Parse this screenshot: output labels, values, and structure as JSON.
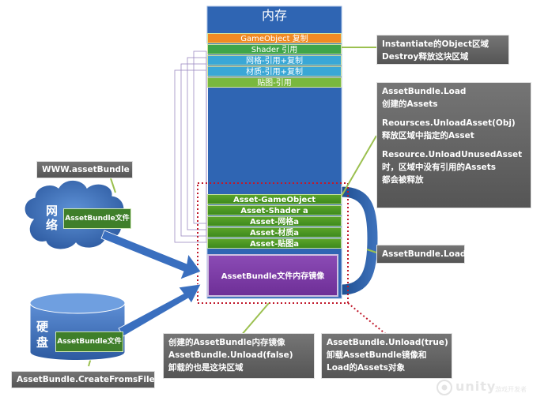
{
  "memory": {
    "title": "内存",
    "stack": [
      {
        "label": "GameObject 复制",
        "color": "#f08a24"
      },
      {
        "label": "Shader 引用",
        "color": "#3fa54a"
      },
      {
        "label": "网格-引用+复制",
        "color": "#3aa7d6"
      },
      {
        "label": "材质-引用+复制",
        "color": "#3aa7d6"
      },
      {
        "label": "贴图-引用",
        "color": "#79b83e"
      }
    ],
    "asset_rows": [
      "Asset-GameObject",
      "Asset-Shader a",
      "Asset-网格a",
      "Asset-材质a",
      "Asset-贴图a"
    ],
    "mirror_label": "AssetBundle文件内存镜像"
  },
  "notes": {
    "instantiate": [
      "Instantiate的Object区域",
      "Destroy释放这块区域"
    ],
    "load_info": [
      "AssetBundle.Load",
      "创建的Assets",
      "",
      "Reoursces.UnloadAsset(Obj)",
      "释放区域中指定的Asset",
      "",
      "Resource.UnloadUnusedAsset",
      "时，区域中没有引用的Assets",
      "都会被释放"
    ],
    "load": "AssetBundle.Load",
    "unload_false": [
      "创建的AssetBundle内存镜像",
      "AssetBundle.Unload(false)",
      "卸载的也是这块区域"
    ],
    "unload_true": [
      "AssetBundle.Unload(true)",
      "卸载AssetBundle镜像和",
      "Load的Assets对象"
    ],
    "www": "WWW.assetBundle",
    "create_from_file": "AssetBundle.CreateFromsFile"
  },
  "sources": {
    "network_label": "网络",
    "disk_label": "硬盘",
    "file_tag_1": "AssetBundle文件",
    "file_tag_2": "AssetBundle文件"
  },
  "brand": {
    "name": "unity",
    "sub": "游戏开发者"
  },
  "colors": {
    "memory_blue": "#2f65b3",
    "note_gray": "#666666",
    "arrow_blue": "#3a6fbf",
    "dotted_red": "#c0182a",
    "connector_green": "#9bc04f"
  }
}
